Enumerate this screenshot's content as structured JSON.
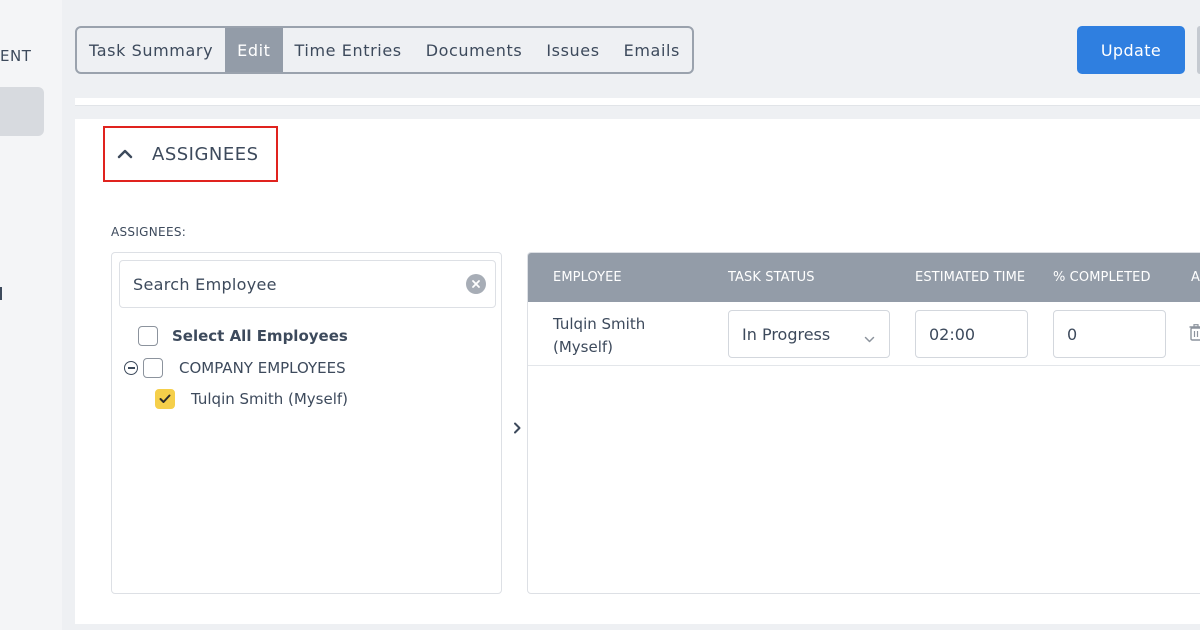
{
  "sidebar": {
    "section_label": "ENT"
  },
  "tabs": [
    {
      "label": "Task Summary",
      "active": false
    },
    {
      "label": "Edit",
      "active": true
    },
    {
      "label": "Time Entries",
      "active": false
    },
    {
      "label": "Documents",
      "active": false
    },
    {
      "label": "Issues",
      "active": false
    },
    {
      "label": "Emails",
      "active": false
    }
  ],
  "update_button": "Update",
  "section": {
    "title": "ASSIGNEES",
    "expanded": true
  },
  "assignees_label": "ASSIGNEES:",
  "employee_picker": {
    "search_placeholder": "Search Employee",
    "select_all_label": "Select All Employees",
    "group_label": "COMPANY EMPLOYEES",
    "employees": [
      {
        "name": "Tulqin Smith (Myself)",
        "checked": true
      }
    ]
  },
  "assigned_table": {
    "columns": [
      "EMPLOYEE",
      "TASK STATUS",
      "ESTIMATED TIME",
      "% COMPLETED",
      "A"
    ],
    "rows": [
      {
        "employee_line1": "Tulqin Smith",
        "employee_line2": "(Myself)",
        "status": "In Progress",
        "estimated_time": "02:00",
        "percent_completed": "0"
      }
    ]
  },
  "colors": {
    "accent": "#2f7fe0",
    "tab_active": "#939ca8",
    "highlight_box": "#e0231e",
    "checkbox_checked": "#f5cf4a"
  }
}
